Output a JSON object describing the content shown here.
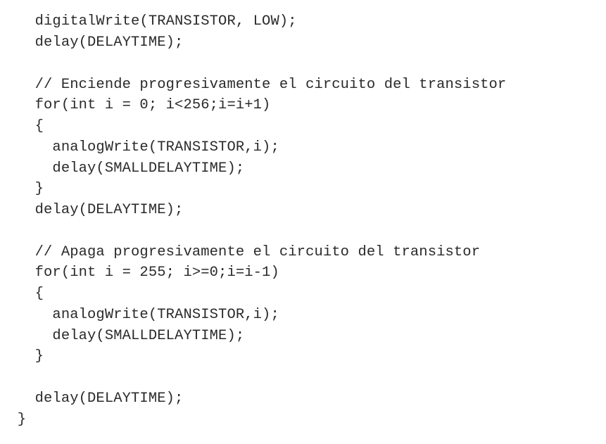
{
  "code": {
    "lines": [
      "    digitalWrite(TRANSISTOR, LOW);",
      "    delay(DELAYTIME);",
      "",
      "    // Enciende progresivamente el circuito del transistor",
      "    for(int i = 0; i<256;i=i+1)",
      "    {",
      "      analogWrite(TRANSISTOR,i);",
      "      delay(SMALLDELAYTIME);",
      "    }",
      "    delay(DELAYTIME);",
      "",
      "    // Apaga progresivamente el circuito del transistor",
      "    for(int i = 255; i>=0;i=i-1)",
      "    {",
      "      analogWrite(TRANSISTOR,i);",
      "      delay(SMALLDELAYTIME);",
      "    }",
      "",
      "    delay(DELAYTIME);",
      "  }"
    ]
  }
}
